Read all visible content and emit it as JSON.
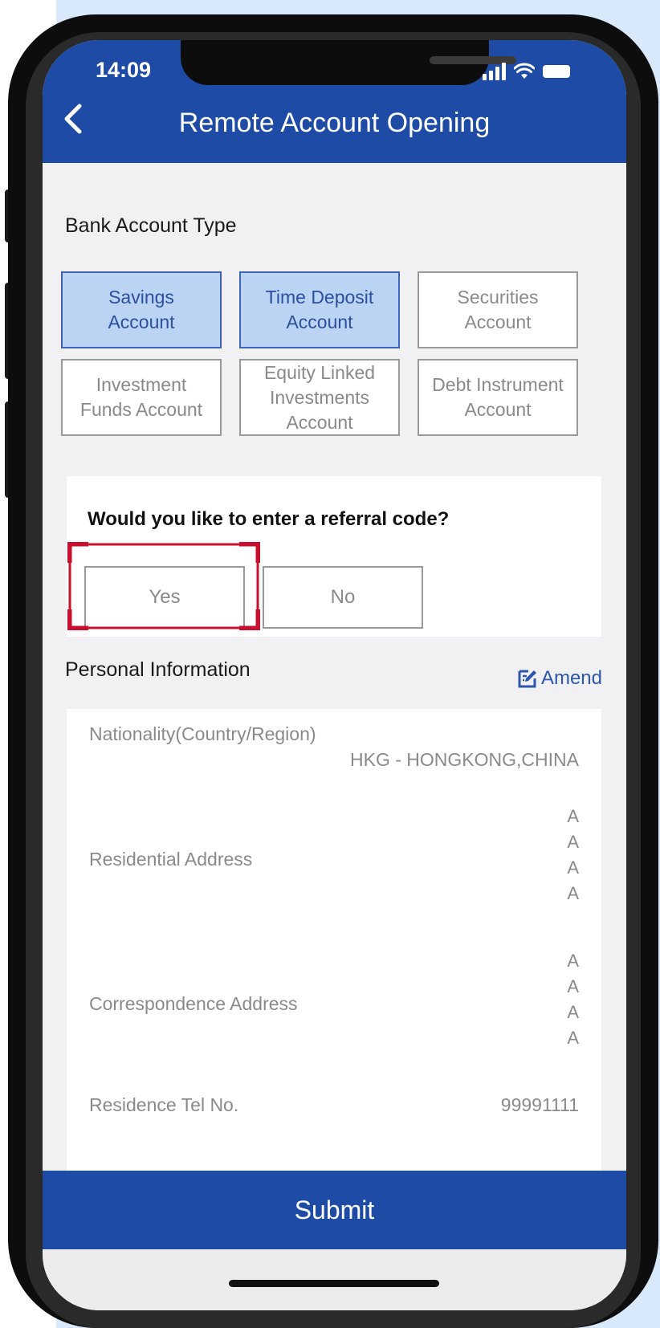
{
  "status_bar": {
    "time": "14:09"
  },
  "header": {
    "title": "Remote Account Opening"
  },
  "bank_account_type": {
    "label": "Bank Account Type",
    "options": [
      {
        "label": "Savings\nAccount",
        "selected": true
      },
      {
        "label": "Time Deposit\nAccount",
        "selected": true
      },
      {
        "label": "Securities\nAccount",
        "selected": false
      },
      {
        "label": "Investment\nFunds Account",
        "selected": false
      },
      {
        "label": "Equity Linked\nInvestments\nAccount",
        "selected": false
      },
      {
        "label": "Debt Instrument\nAccount",
        "selected": false
      }
    ]
  },
  "referral": {
    "question": "Would you like to enter a referral code?",
    "yes_label": "Yes",
    "no_label": "No"
  },
  "personal_info": {
    "label": "Personal Information",
    "amend_label": "Amend",
    "nationality_label": "Nationality(Country/Region)",
    "nationality_value": "HKG - HONGKONG,CHINA",
    "residential_label": "Residential Address",
    "residential_lines": [
      "A",
      "A",
      "A",
      "A"
    ],
    "correspondence_label": "Correspondence Address",
    "correspondence_lines": [
      "A",
      "A",
      "A",
      "A"
    ],
    "tel_label": "Residence Tel No.",
    "tel_value": "99991111"
  },
  "footer": {
    "submit_label": "Submit"
  },
  "colors": {
    "primary": "#1e4ba5",
    "selected_bg": "#bcd4f4",
    "highlight": "#c8102e"
  }
}
